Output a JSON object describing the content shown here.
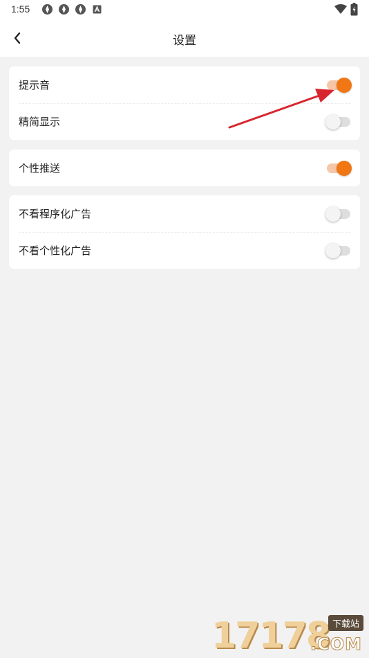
{
  "status_bar": {
    "time": "1:55",
    "icons": [
      "app-notification-icon",
      "app-notification-icon",
      "app-notification-icon",
      "a-badge-icon",
      "wifi-icon",
      "battery-icon"
    ]
  },
  "header": {
    "title": "设置",
    "back_icon": "back-chevron-icon"
  },
  "groups": [
    {
      "items": [
        {
          "label": "提示音",
          "enabled": true
        },
        {
          "label": "精简显示",
          "enabled": false
        }
      ]
    },
    {
      "items": [
        {
          "label": "个性推送",
          "enabled": true
        }
      ]
    },
    {
      "items": [
        {
          "label": "不看程序化广告",
          "enabled": false
        },
        {
          "label": "不看个性化广告",
          "enabled": false
        }
      ]
    }
  ],
  "colors": {
    "accent": "#f07714",
    "accent_track": "#f6c6a8",
    "off_track": "#dedede",
    "annotation_arrow": "#d8262e",
    "background": "#f2f2f2"
  },
  "watermark": {
    "digits": "17178",
    "badge": "下载站",
    "suffix": ".COM"
  }
}
